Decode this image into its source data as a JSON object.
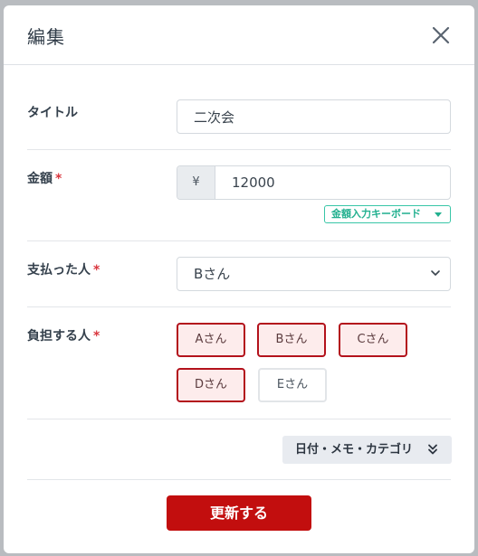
{
  "modal": {
    "title": "編集",
    "close_icon": "close-icon"
  },
  "form": {
    "title_field": {
      "label": "タイトル",
      "value": "二次会"
    },
    "amount_field": {
      "label": "金額",
      "required_mark": "*",
      "currency_symbol": "¥",
      "value": "12000",
      "keyboard_button": "金額入力キーボード",
      "keyboard_icon": "caret-down-icon"
    },
    "payer_field": {
      "label": "支払った人",
      "required_mark": "*",
      "selected": "Bさん",
      "chevron_icon": "chevron-down-icon"
    },
    "burden_field": {
      "label": "負担する人",
      "required_mark": "*",
      "people": [
        {
          "name": "Aさん",
          "selected": true
        },
        {
          "name": "Bさん",
          "selected": true
        },
        {
          "name": "Cさん",
          "selected": true
        },
        {
          "name": "Dさん",
          "selected": true
        },
        {
          "name": "Eさん",
          "selected": false
        }
      ]
    },
    "more_options": {
      "label": "日付・メモ・カテゴリ",
      "icon": "double-chevron-down-icon"
    },
    "submit_label": "更新する"
  },
  "colors": {
    "accent": "#c20e0e",
    "required": "#d9363e",
    "keyboard": "#22b08f",
    "selected_bg": "#fdecec"
  }
}
